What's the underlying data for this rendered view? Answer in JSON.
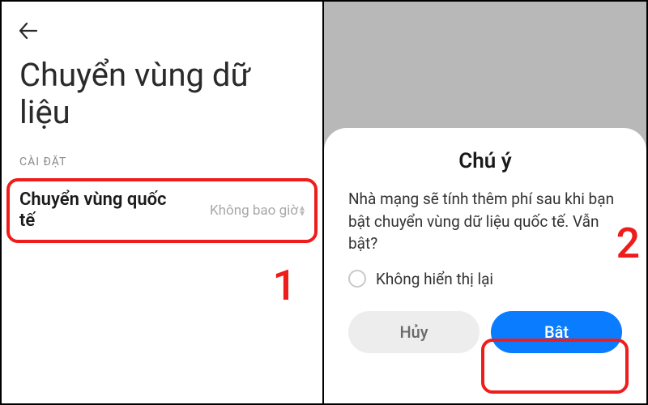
{
  "left": {
    "title": "Chuyển vùng dữ liệu",
    "section": "CÀI ĐẶT",
    "row_label": "Chuyển vùng quốc tế",
    "row_value": "Không bao giờ",
    "step": "1"
  },
  "right": {
    "dialog_title": "Chú ý",
    "dialog_message": "Nhà mạng sẽ tính thêm phí sau khi bạn bật chuyển vùng dữ liệu quốc tế. Vẫn bật?",
    "dont_show": "Không hiển thị lại",
    "cancel": "Hủy",
    "confirm": "Bật",
    "step": "2"
  }
}
